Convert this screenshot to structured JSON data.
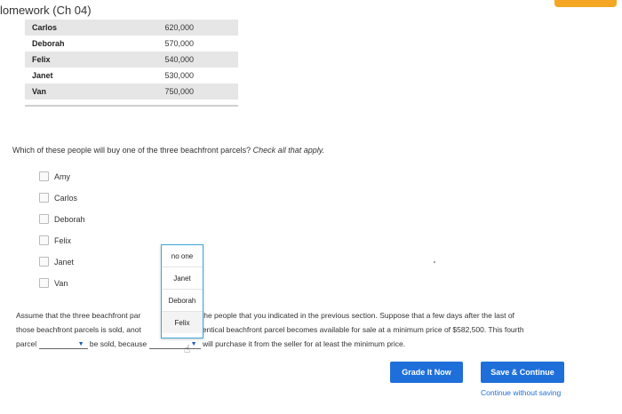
{
  "header": {
    "title": "lomework (Ch 04)"
  },
  "table": {
    "rows": [
      {
        "name": "Carlos",
        "value": "620,000"
      },
      {
        "name": "Deborah",
        "value": "570,000"
      },
      {
        "name": "Felix",
        "value": "540,000"
      },
      {
        "name": "Janet",
        "value": "530,000"
      },
      {
        "name": "Van",
        "value": "750,000"
      }
    ]
  },
  "question": {
    "text": "Which of these people will buy one of the three beachfront parcels? ",
    "instruction": "Check all that apply."
  },
  "options": [
    "Amy",
    "Carlos",
    "Deborah",
    "Felix",
    "Janet",
    "Van"
  ],
  "paragraph": {
    "line1_a": "Assume that the three beachfront par",
    "line1_b": "d to the people that you indicated in the previous section. Suppose that a few days after the last of",
    "line2_a": "those beachfront parcels is sold, anot",
    "line2_b": "lly identical beachfront parcel becomes available for sale at a minimum price of $582,500. This fourth",
    "line3_a": "parcel",
    "line3_b": "be sold, because",
    "line3_c": "will purchase it from the seller for at least the minimum price."
  },
  "dropdown": {
    "items": [
      "no one",
      "Janet",
      "Deborah",
      "Felix"
    ]
  },
  "buttons": {
    "grade": "Grade It Now",
    "save": "Save & Continue"
  },
  "link": {
    "continue": "Continue without saving"
  }
}
